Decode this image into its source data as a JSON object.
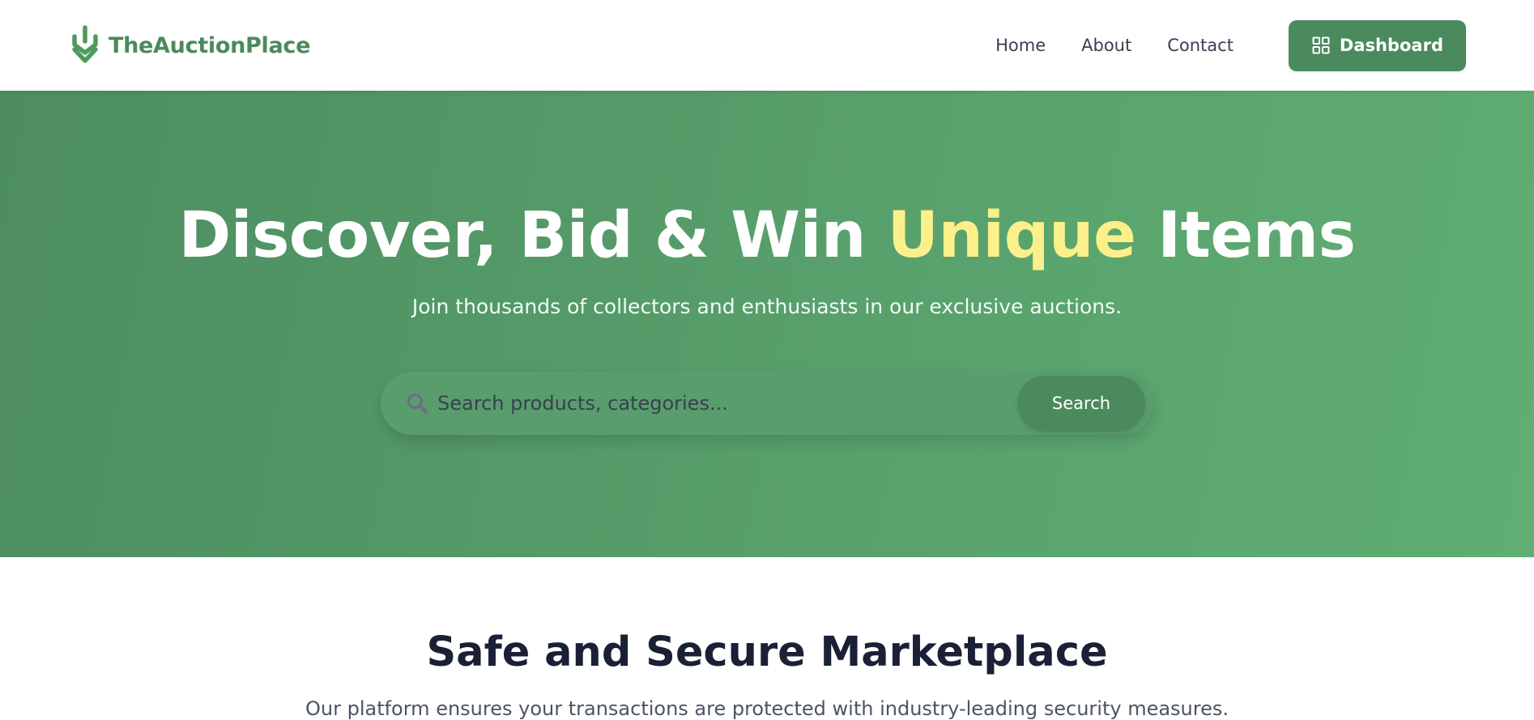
{
  "brand": {
    "name": "TheAuctionPlace",
    "icon": "sprout-logo-icon",
    "color": "#4a8a5c"
  },
  "nav": {
    "links": [
      {
        "label": "Home"
      },
      {
        "label": "About"
      },
      {
        "label": "Contact"
      }
    ],
    "dashboard": {
      "label": "Dashboard",
      "icon": "grid-icon"
    }
  },
  "hero": {
    "title_part1": "Discover, Bid & Win ",
    "title_highlight": "Unique",
    "title_part2": " Items",
    "subtitle": "Join thousands of collectors and enthusiasts in our exclusive auctions.",
    "search": {
      "placeholder": "Search products, categories...",
      "value": "",
      "button_label": "Search",
      "icon": "search-icon"
    },
    "colors": {
      "background_start": "#4d8d60",
      "background_end": "#60ae74",
      "highlight": "#fdf08a"
    }
  },
  "secure": {
    "title": "Safe and Secure Marketplace",
    "text": "Our platform ensures your transactions are protected with industry-leading security measures."
  }
}
